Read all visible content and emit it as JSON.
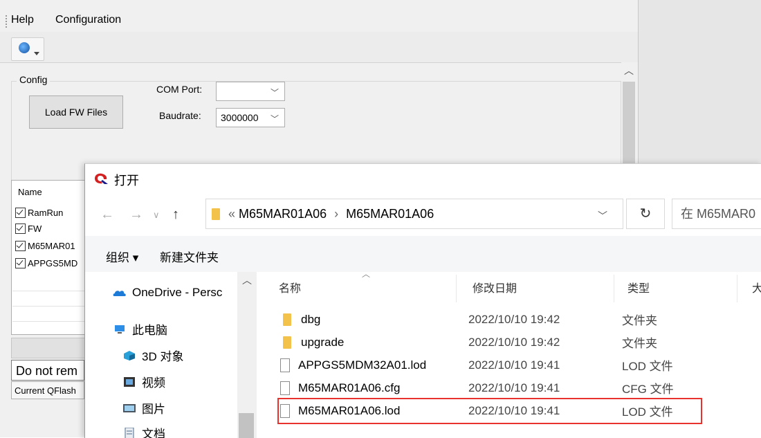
{
  "menu": {
    "help": "Help",
    "configuration": "Configuration"
  },
  "config": {
    "legend": "Config",
    "load_button": "Load FW Files",
    "com_port_label": "COM Port:",
    "com_port_value": "",
    "baudrate_label": "Baudrate:",
    "baudrate_value": "3000000"
  },
  "list": {
    "header": "Name",
    "items": [
      "RamRun",
      "FW",
      "M65MAR01",
      "APPGS5MD"
    ]
  },
  "status": {
    "message": "Do not rem",
    "current": "Current QFlash"
  },
  "dialog": {
    "title": "打开",
    "address": {
      "prefix": "«",
      "segment1": "M65MAR01A06",
      "separator": "›",
      "segment2": "M65MAR01A06"
    },
    "search_placeholder": "在 M65MAR0",
    "organize_label": "组织 ▾",
    "new_folder_label": "新建文件夹",
    "nav_items": [
      {
        "label": "OneDrive - Persc",
        "icon": "onedrive-icon"
      },
      {
        "label": "此电脑",
        "icon": "computer-icon"
      },
      {
        "label": "3D 对象",
        "icon": "3d-objects-icon"
      },
      {
        "label": "视频",
        "icon": "video-icon"
      },
      {
        "label": "图片",
        "icon": "pictures-icon"
      },
      {
        "label": "文档",
        "icon": "documents-icon"
      }
    ],
    "columns": {
      "name": "名称",
      "modified": "修改日期",
      "type": "类型",
      "size": "大"
    },
    "files": [
      {
        "name": "dbg",
        "modified": "2022/10/10 19:42",
        "type": "文件夹",
        "kind": "folder"
      },
      {
        "name": "upgrade",
        "modified": "2022/10/10 19:42",
        "type": "文件夹",
        "kind": "folder"
      },
      {
        "name": "APPGS5MDM32A01.lod",
        "modified": "2022/10/10 19:41",
        "type": "LOD 文件",
        "kind": "file"
      },
      {
        "name": "M65MAR01A06.cfg",
        "modified": "2022/10/10 19:41",
        "type": "CFG 文件",
        "kind": "file"
      },
      {
        "name": "M65MAR01A06.lod",
        "modified": "2022/10/10 19:41",
        "type": "LOD 文件",
        "kind": "file",
        "highlighted": true
      }
    ]
  },
  "colors": {
    "highlight": "#e8322d",
    "folder": "#f3c24a",
    "onedrive": "#1d7ad6"
  }
}
